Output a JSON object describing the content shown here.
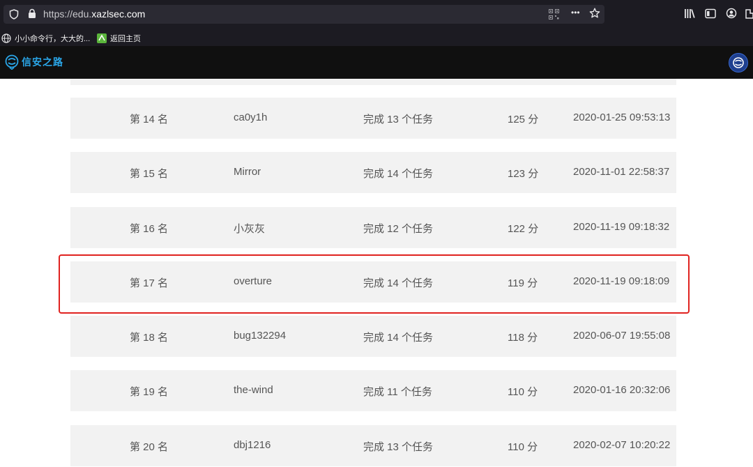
{
  "browser": {
    "url_prefix": "https://edu.",
    "url_domain": "xazlsec.com",
    "more_icon": "•••",
    "bookmark_icon": "star-icon",
    "library_icon": "library-icon",
    "reader_icon": "reader-view-icon",
    "account_icon": "account-icon",
    "shield_icon": "shield-icon",
    "lock_icon": "lock-icon",
    "qr_icon": "qr-code-icon"
  },
  "bookmarks": [
    {
      "label": "小小命令行，大大的..."
    },
    {
      "label": "返回主页"
    }
  ],
  "site": {
    "logo_text": "信安之路",
    "brand_color": "#2aa6e8"
  },
  "ranking": [
    {
      "rank": "第 14 名",
      "name": "ca0y1h",
      "tasks": "完成 13 个任务",
      "score": "125 分",
      "time": "2020-01-25 09:53:13"
    },
    {
      "rank": "第 15 名",
      "name": "Mirror",
      "tasks": "完成 14 个任务",
      "score": "123 分",
      "time": "2020-11-01 22:58:37"
    },
    {
      "rank": "第 16 名",
      "name": "小灰灰",
      "tasks": "完成 12 个任务",
      "score": "122 分",
      "time": "2020-11-19 09:18:32"
    },
    {
      "rank": "第 17 名",
      "name": "overture",
      "tasks": "完成 14 个任务",
      "score": "119 分",
      "time": "2020-11-19 09:18:09"
    },
    {
      "rank": "第 18 名",
      "name": "bug132294",
      "tasks": "完成 14 个任务",
      "score": "118 分",
      "time": "2020-06-07 19:55:08"
    },
    {
      "rank": "第 19 名",
      "name": "the-wind",
      "tasks": "完成 11 个任务",
      "score": "110 分",
      "time": "2020-01-16 20:32:06"
    },
    {
      "rank": "第 20 名",
      "name": "dbj1216",
      "tasks": "完成 13 个任务",
      "score": "110 分",
      "time": "2020-02-07 10:20:22"
    }
  ],
  "highlight_color": "#e0221f"
}
